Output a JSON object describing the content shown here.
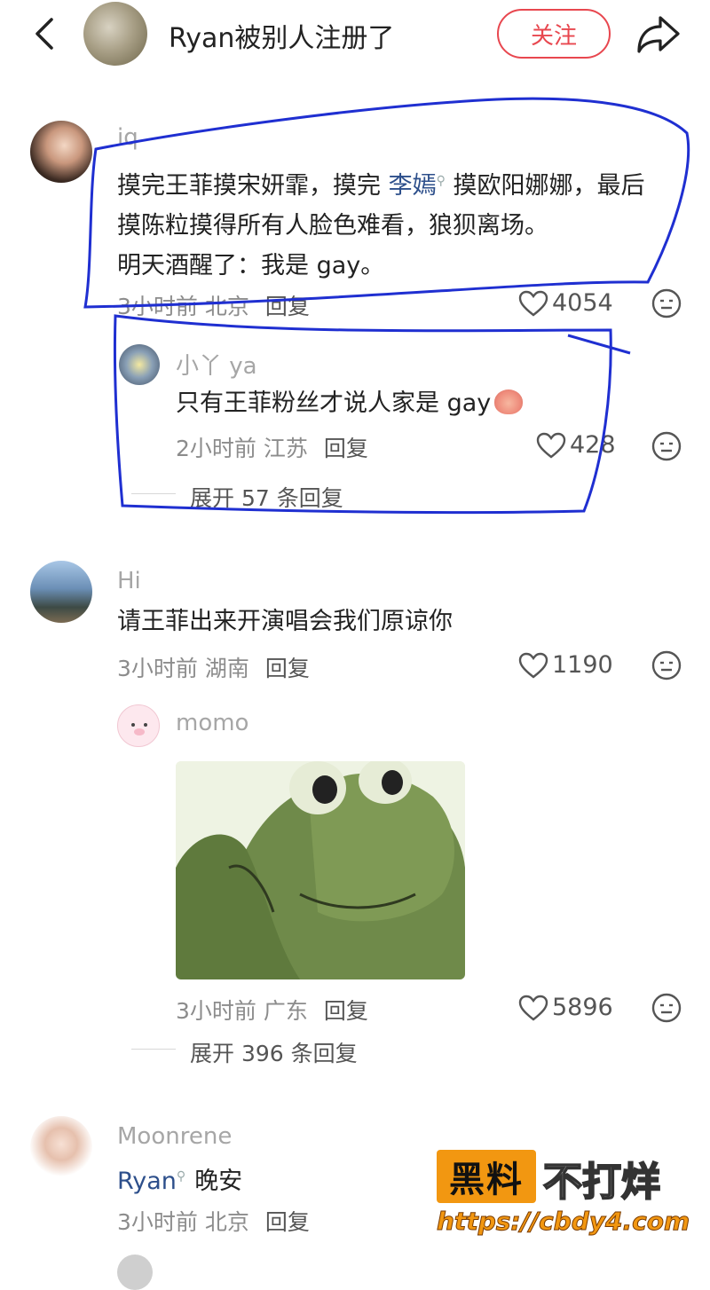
{
  "header": {
    "back_icon": "chevron-left-icon",
    "title": "Ryan被别人注册了",
    "follow_label": "关注",
    "share_icon": "share-icon"
  },
  "comments": [
    {
      "name": "iq",
      "text_parts": [
        "摸完王菲摸宋妍霏，摸完 ",
        "李嫣",
        " 摸欧阳娜娜，最后"
      ],
      "line2": "摸陈粒摸得所有人脸色难看，狼狈离场。",
      "line3": "明天酒醒了：我是 gay。",
      "meta": "3小时前 北京",
      "reply": "回复",
      "likes": "4054",
      "reply_item": {
        "name": "小丫 ya",
        "text": "只有王菲粉丝才说人家是 gay",
        "meta": "2小时前 江苏",
        "reply": "回复",
        "likes": "428"
      },
      "expand": "展开 57 条回复"
    },
    {
      "name": "Hi",
      "text": "请王菲出来开演唱会我们原谅你",
      "meta": "3小时前 湖南",
      "reply": "回复",
      "likes": "1190",
      "reply_item": {
        "name": "momo",
        "image": "frog-sticker",
        "meta": "3小时前 广东",
        "reply": "回复",
        "likes": "5896"
      },
      "expand": "展开 396 条回复"
    },
    {
      "name": "Moonrene",
      "mention": "Ryan",
      "text": "晚安",
      "meta": "3小时前 北京",
      "reply": "回复"
    }
  ],
  "watermark": {
    "box": "黑料",
    "text": "不打烊",
    "url": "https://cbdy4.com"
  },
  "colors": {
    "accent": "#e8474f",
    "annotation": "#1f2fd1",
    "watermark": "#f29711"
  }
}
